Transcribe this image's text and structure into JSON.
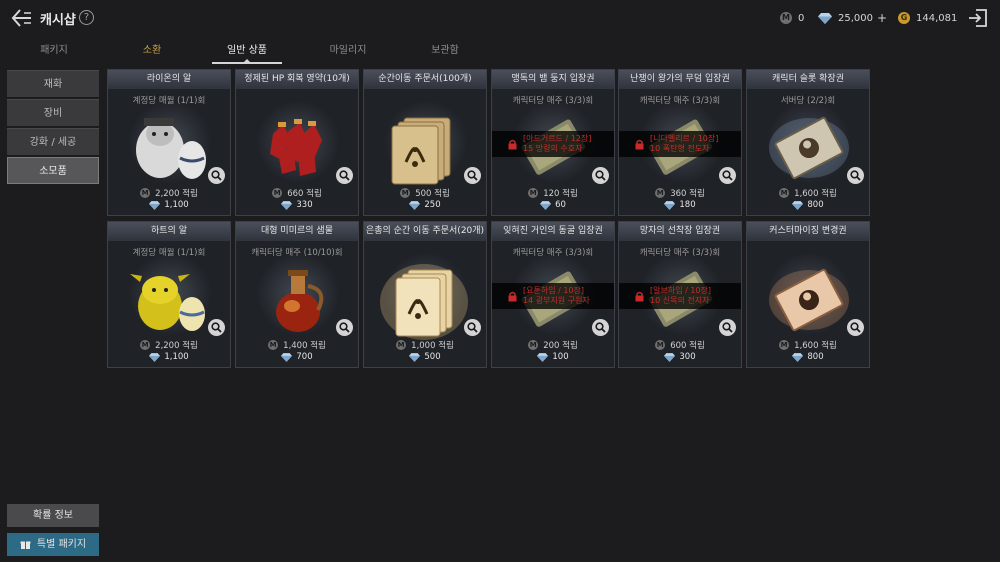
{
  "header": {
    "title": "캐시샵",
    "help": "?",
    "mileage": "0",
    "diamonds": "25,000",
    "gold": "144,081",
    "mileage_coin": "M",
    "gold_coin": "G",
    "plus": "+"
  },
  "tabs": [
    {
      "label": "패키지"
    },
    {
      "label": "소환"
    },
    {
      "label": "일반 상품"
    },
    {
      "label": "마일리지"
    },
    {
      "label": "보관함"
    }
  ],
  "sidebar": {
    "items": [
      {
        "label": "재화"
      },
      {
        "label": "장비"
      },
      {
        "label": "강화 / 세공"
      },
      {
        "label": "소모품"
      }
    ],
    "bottom": {
      "prob_info": "확률 정보",
      "special_package": "특별 패키지"
    }
  },
  "products": [
    {
      "name": "라이온의 알",
      "limit": "계정당 매월 (1/1)회",
      "points": "2,200 적립",
      "price": "1,100",
      "art": "lion-egg",
      "locked": false
    },
    {
      "name": "정제된 HP 회복 영약(10개)",
      "limit": "",
      "points": "660 적립",
      "price": "330",
      "art": "potion-bundle",
      "locked": false
    },
    {
      "name": "순간이동 주문서(100개)",
      "limit": "",
      "points": "500 적립",
      "price": "250",
      "art": "scroll-stack",
      "locked": false
    },
    {
      "name": "맹독의 뱀 둥지 입장권",
      "limit": "캐릭터당 매주 (3/3)회",
      "points": "120 적립",
      "price": "60",
      "art": "ticket",
      "locked": true,
      "lock_line1": "[아드거르드 / 12장]",
      "lock_line2": "15 망령의 수호자"
    },
    {
      "name": "난쟁이 왕가의 무덤 입장권",
      "limit": "캐릭터당 매주 (3/3)회",
      "points": "360 적립",
      "price": "180",
      "art": "ticket",
      "locked": true,
      "lock_line1": "[니다벨리르 / 10장]",
      "lock_line2": "10 폭탄형 전도자"
    },
    {
      "name": "캐릭터 슬롯 확장권",
      "limit": "서버당 (2/2)회",
      "points": "1,600 적립",
      "price": "800",
      "art": "slot-card",
      "locked": false
    },
    {
      "name": "하트의 알",
      "limit": "계정당 매월 (1/1)회",
      "points": "2,200 적립",
      "price": "1,100",
      "art": "heart-egg",
      "locked": false
    },
    {
      "name": "대형 미미르의 샘물",
      "limit": "캐릭터당 매주 (10/10)회",
      "points": "1,400 적립",
      "price": "700",
      "art": "flask",
      "locked": false
    },
    {
      "name": "은총의 순간 이동 주문서(20개)",
      "limit": "",
      "points": "1,000 적립",
      "price": "500",
      "art": "scroll-stack-gold",
      "locked": false
    },
    {
      "name": "잊혀진 거인의 동굴 입장권",
      "limit": "캐릭터당 매주 (3/3)회",
      "points": "200 적립",
      "price": "100",
      "art": "ticket",
      "locked": true,
      "lock_line1": "[요툰하임 / 10장]",
      "lock_line2": "14 광부지원 구원자"
    },
    {
      "name": "망자의 선착장 입장권",
      "limit": "캐릭터당 매주 (3/3)회",
      "points": "600 적립",
      "price": "300",
      "art": "ticket",
      "locked": true,
      "lock_line1": "[알브하임 / 10장]",
      "lock_line2": "10 신목의 전지자"
    },
    {
      "name": "커스터마이징 변경권",
      "limit": "",
      "points": "1,600 적립",
      "price": "800",
      "art": "custom-card",
      "locked": false
    }
  ],
  "colors": {
    "background": "#1c1c1e",
    "card": "#1f2227",
    "accent_gold": "#c9a24a",
    "lock_red": "#c82b2b",
    "teal_button": "#2c6a86"
  }
}
